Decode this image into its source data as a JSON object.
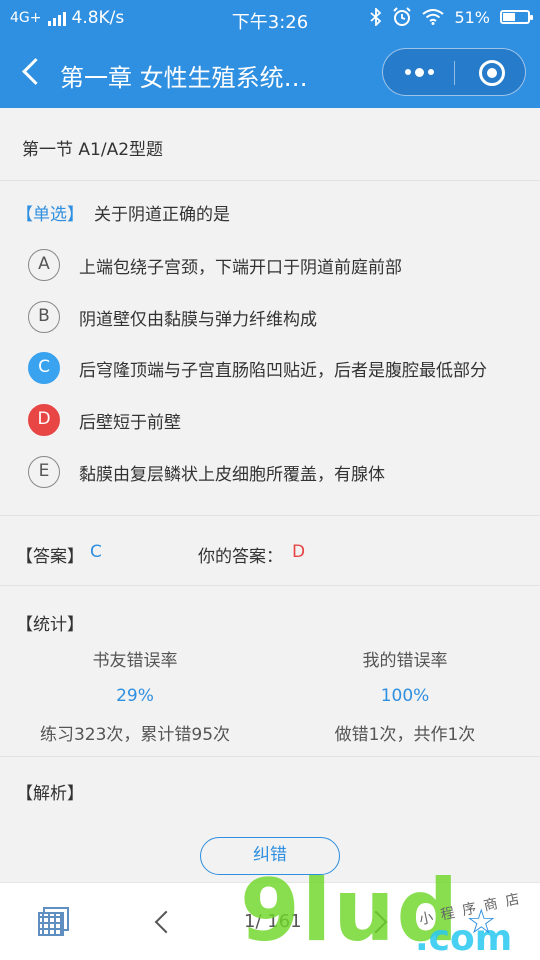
{
  "status_bar": {
    "network": "4G+",
    "speed": "4.8K/s",
    "time": "下午3:26",
    "battery": "51%",
    "battery_level": 0.51,
    "icons": [
      "bluetooth-icon",
      "alarm-icon",
      "wifi-icon",
      "battery-icon"
    ]
  },
  "nav": {
    "title": "第一章 女性生殖系统…"
  },
  "section_title": "第一节 A1/A2型题",
  "question": {
    "type_tag": "【单选】",
    "text": "关于阴道正确的是",
    "options": [
      {
        "letter": "A",
        "text": "上端包绕子宫颈，下端开口于阴道前庭前部",
        "state": "normal"
      },
      {
        "letter": "B",
        "text": "阴道壁仅由黏膜与弹力纤维构成",
        "state": "normal"
      },
      {
        "letter": "C",
        "text": "后穹隆顶端与子宫直肠陷凹贴近，后者是腹腔最低部分",
        "state": "correct"
      },
      {
        "letter": "D",
        "text": "后壁短于前壁",
        "state": "wrong"
      },
      {
        "letter": "E",
        "text": "黏膜由复层鳞状上皮细胞所覆盖，有腺体",
        "state": "normal"
      }
    ]
  },
  "answer": {
    "label": "【答案】",
    "value": "C",
    "your_label": "你的答案：",
    "your_value": "D"
  },
  "stats": {
    "label": "【统计】",
    "friends": {
      "title": "书友错误率",
      "percent": "29%",
      "detail": "练习323次，累计错95次"
    },
    "mine": {
      "title": "我的错误率",
      "percent": "100%",
      "detail": "做错1次，共作1次"
    }
  },
  "analysis": {
    "label": "【解析】",
    "fix_button": "纠错"
  },
  "bottom": {
    "pager": "1/ 161"
  },
  "watermark": {
    "main": "9lud",
    "suffix": ".com",
    "caption": "小程序商店"
  },
  "colors": {
    "primary": "#2f8fe0",
    "correct": "#3aa3f0",
    "wrong": "#e84545"
  }
}
